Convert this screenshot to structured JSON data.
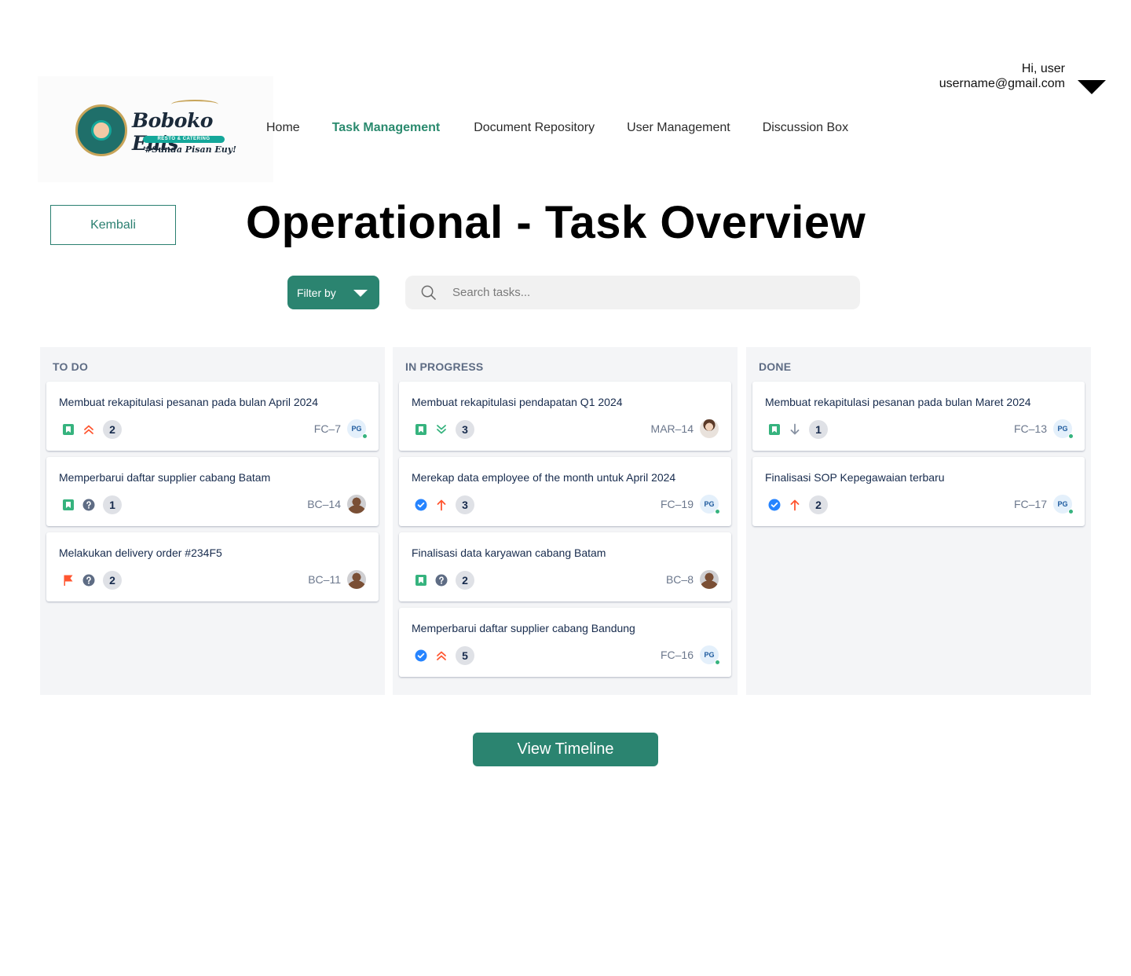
{
  "brand": {
    "name": "Boboko Euis",
    "band": "RESTO & CATERING",
    "tagline": "#Sunda Pisan Euy!"
  },
  "nav": {
    "items": [
      {
        "label": "Home",
        "active": false
      },
      {
        "label": "Task Management",
        "active": true
      },
      {
        "label": "Document Repository",
        "active": false
      },
      {
        "label": "User Management",
        "active": false
      },
      {
        "label": "Discussion Box",
        "active": false
      }
    ]
  },
  "user": {
    "greeting": "Hi, user",
    "email": "username@gmail.com",
    "menu_icon": "caret-down-icon"
  },
  "page": {
    "back_label": "Kembali",
    "title": "Operational - Task Overview"
  },
  "toolbar": {
    "filter_label": "Filter by",
    "search_placeholder": "Search tasks...",
    "search_value": ""
  },
  "board": {
    "columns": [
      {
        "title": "TO DO",
        "cards": [
          {
            "title": "Membuat rekapitulasi pesanan pada bulan April 2024",
            "type": "story",
            "priority": "highest",
            "points": "2",
            "key": "FC–7",
            "assignee": {
              "type": "initials",
              "initials": "PG",
              "online": true
            }
          },
          {
            "title": "Memperbarui daftar supplier cabang Batam",
            "type": "story",
            "priority": "unknown",
            "points": "1",
            "key": "BC–14",
            "assignee": {
              "type": "photo-dark",
              "online": false
            }
          },
          {
            "title": "Melakukan delivery order #234F5",
            "type": "flag",
            "priority": "unknown",
            "points": "2",
            "key": "BC–11",
            "assignee": {
              "type": "photo-dark",
              "online": false
            }
          }
        ]
      },
      {
        "title": "IN PROGRESS",
        "cards": [
          {
            "title": "Membuat rekapitulasi pendapatan Q1 2024",
            "type": "story",
            "priority": "lowest",
            "points": "3",
            "key": "MAR–14",
            "assignee": {
              "type": "photo-light",
              "online": false
            }
          },
          {
            "title": "Merekap data employee of the month untuk April 2024",
            "type": "task",
            "priority": "high",
            "points": "3",
            "key": "FC–19",
            "assignee": {
              "type": "initials",
              "initials": "PG",
              "online": true
            }
          },
          {
            "title": "Finalisasi data karyawan cabang Batam",
            "type": "story",
            "priority": "unknown",
            "points": "2",
            "key": "BC–8",
            "assignee": {
              "type": "photo-dark",
              "online": false
            }
          },
          {
            "title": "Memperbarui daftar supplier cabang Bandung",
            "type": "task",
            "priority": "highest",
            "points": "5",
            "key": "FC–16",
            "assignee": {
              "type": "initials",
              "initials": "PG",
              "online": true
            }
          }
        ]
      },
      {
        "title": "DONE",
        "cards": [
          {
            "title": "Membuat rekapitulasi pesanan pada bulan Maret 2024",
            "type": "story",
            "priority": "low",
            "points": "1",
            "key": "FC–13",
            "assignee": {
              "type": "initials",
              "initials": "PG",
              "online": true
            }
          },
          {
            "title": "Finalisasi SOP Kepegawaian terbaru",
            "type": "task",
            "priority": "high",
            "points": "2",
            "key": "FC–17",
            "assignee": {
              "type": "initials",
              "initials": "PG",
              "online": true
            }
          }
        ]
      }
    ]
  },
  "footer": {
    "timeline_label": "View Timeline"
  },
  "colors": {
    "accent": "#2b8470",
    "nav_active": "#2a8a6e",
    "column_bg": "#f4f5f7",
    "story": "#36b37e",
    "task": "#2684ff",
    "flag": "#ff5630",
    "priority_up": "#ff5630",
    "priority_down": "#36b37e"
  }
}
